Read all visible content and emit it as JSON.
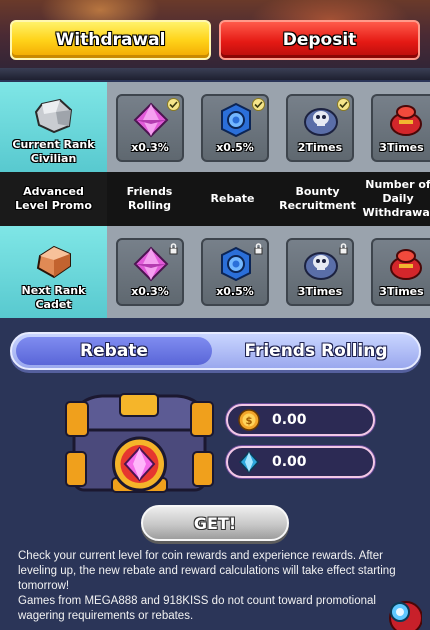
{
  "header": {
    "withdraw_label": "Withdrawal",
    "deposit_label": "Deposit"
  },
  "current_rank": {
    "label": "Current Rank",
    "name": "Civilian",
    "rewards": [
      {
        "icon": "pink-gem-icon",
        "value": "x0.3%",
        "status": "unlocked"
      },
      {
        "icon": "blue-ring-icon",
        "value": "x0.5%",
        "status": "unlocked"
      },
      {
        "icon": "skull-bag-icon",
        "value": "2Times",
        "status": "unlocked"
      },
      {
        "icon": "red-bag-icon",
        "value": "3Times",
        "status": "unlocked"
      }
    ]
  },
  "promo_header": {
    "title": "Advanced Level Promo",
    "columns": [
      "Friends Rolling",
      "Rebate",
      "Bounty Recruitment",
      "Number of Daily Withdrawal"
    ]
  },
  "next_rank": {
    "label": "Next Rank",
    "name": "Cadet",
    "rewards": [
      {
        "icon": "pink-gem-icon",
        "value": "x0.3%",
        "status": "locked"
      },
      {
        "icon": "blue-ring-icon",
        "value": "x0.5%",
        "status": "locked"
      },
      {
        "icon": "skull-bag-icon",
        "value": "3Times",
        "status": "locked"
      },
      {
        "icon": "red-bag-icon",
        "value": "3Times",
        "status": "locked"
      }
    ]
  },
  "tabs": {
    "active": "Rebate",
    "inactive": "Friends Rolling"
  },
  "rewards_panel": {
    "coin_amount": "0.00",
    "diamond_amount": "0.00",
    "get_label": "GET!"
  },
  "notes": [
    "Check your current level for coin rewards and experience rewards. After leveling up, the new rebate and reward calculations will take effect starting tomorrow!",
    "Games from MEGA888 and 918KISS do not count toward promotional wagering requirements or rebates."
  ],
  "colors": {
    "withdraw": "#ffd31a",
    "deposit": "#e51a14",
    "rank_cell": "#6fdcdf",
    "tab_active": "#6b78e4"
  }
}
